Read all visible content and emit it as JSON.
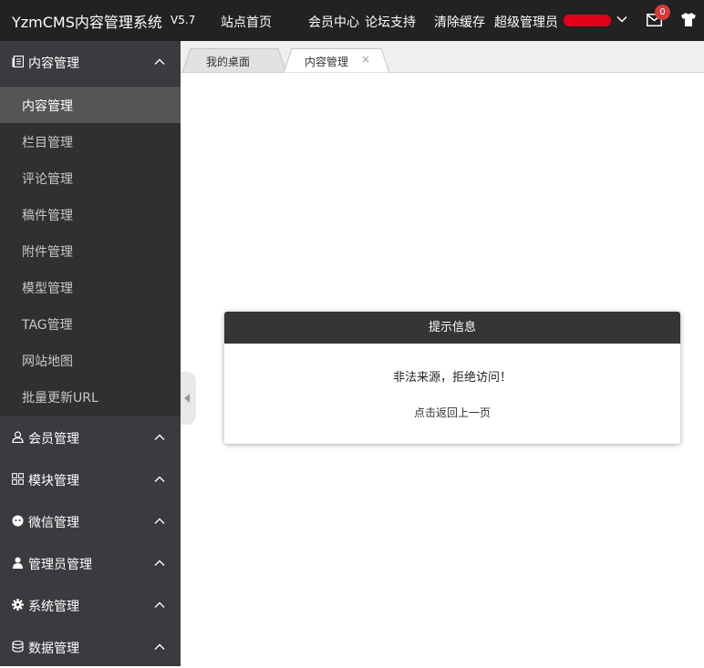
{
  "header": {
    "brand": "YzmCMS内容管理系统",
    "version": "V5.7",
    "nav": [
      "站点首页",
      "会员中心",
      "论坛支持",
      "清除缓存"
    ],
    "user_role": "超级管理员",
    "message_count": "0",
    "icons": [
      "chevron-down-icon",
      "mail-icon",
      "shirt-icon"
    ]
  },
  "sidebar": {
    "groups": [
      {
        "label": "内容管理",
        "icon": "document-icon",
        "expanded": true
      },
      {
        "label": "会员管理",
        "icon": "user-icon"
      },
      {
        "label": "模块管理",
        "icon": "grid-icon"
      },
      {
        "label": "微信管理",
        "icon": "wechat-icon"
      },
      {
        "label": "管理员管理",
        "icon": "admin-icon"
      },
      {
        "label": "系统管理",
        "icon": "gear-icon"
      },
      {
        "label": "数据管理",
        "icon": "database-icon"
      }
    ],
    "content_items": [
      "内容管理",
      "栏目管理",
      "评论管理",
      "稿件管理",
      "附件管理",
      "模型管理",
      "TAG管理",
      "网站地图",
      "批量更新URL"
    ],
    "active_item": "内容管理"
  },
  "tabs": [
    {
      "label": "我的桌面",
      "active": false
    },
    {
      "label": "内容管理",
      "active": true,
      "close": "×"
    }
  ],
  "dialog": {
    "title": "提示信息",
    "message": "非法来源，拒绝访问！",
    "back_link": "点击返回上一页"
  },
  "colors": {
    "topbar": "#222222",
    "sidebar": "#3a3a3f",
    "submenu": "#303030",
    "active_item": "#555555",
    "badge": "#d63a3a"
  }
}
